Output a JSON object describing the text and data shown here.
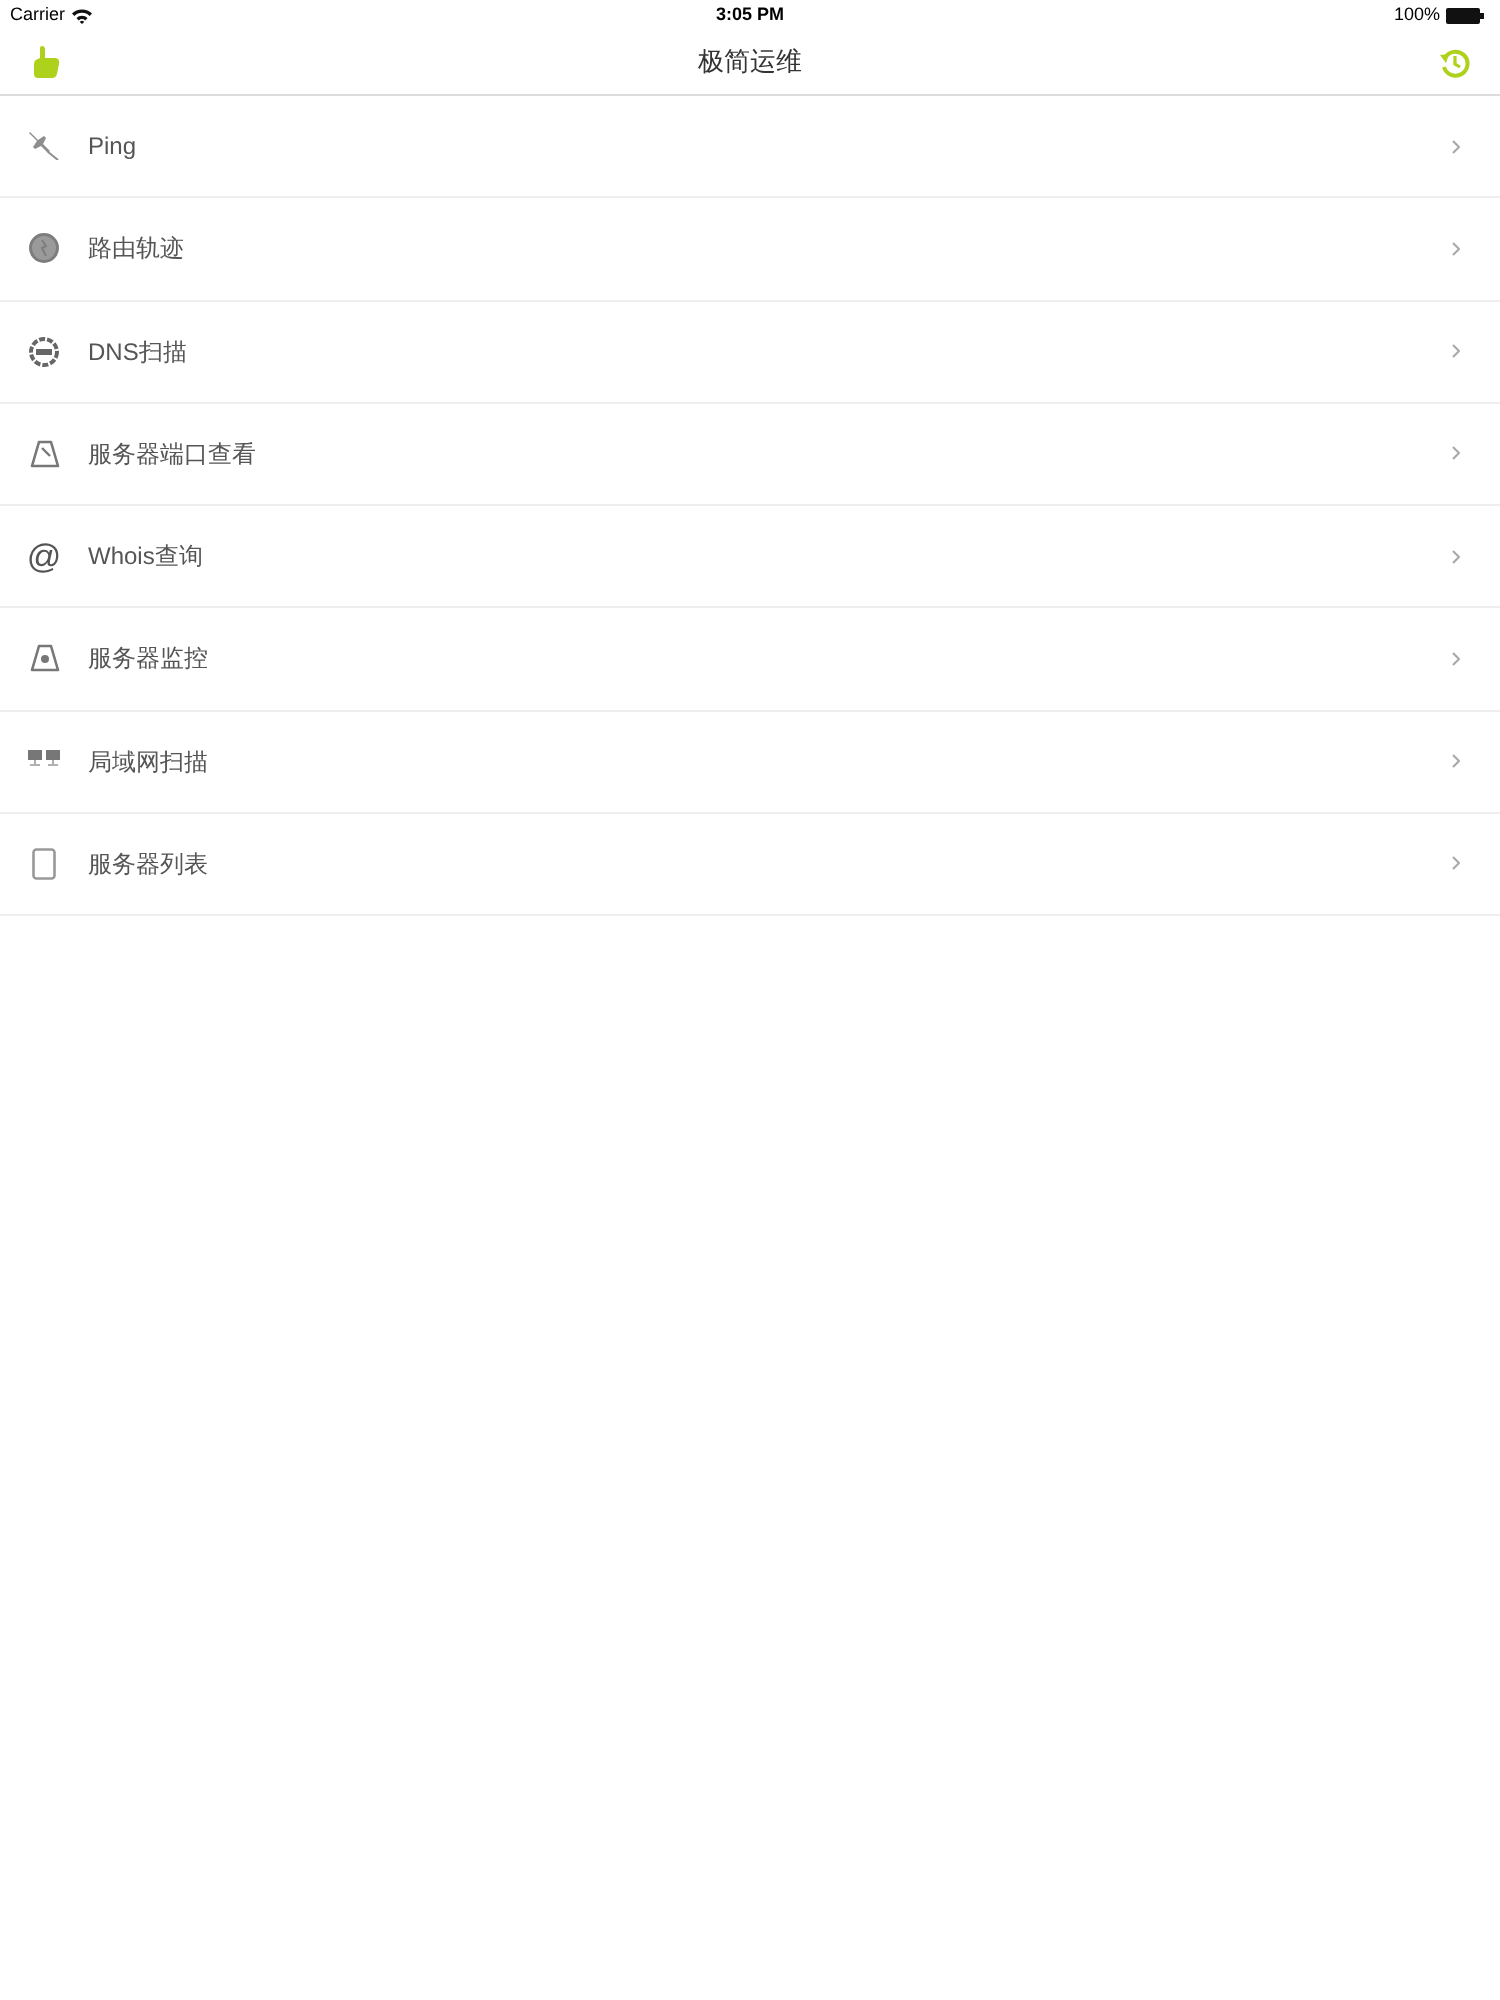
{
  "status_bar": {
    "carrier": "Carrier",
    "time": "3:05 PM",
    "battery": "100%"
  },
  "nav_bar": {
    "title": "极简运维"
  },
  "menu": {
    "items": [
      {
        "label": "Ping"
      },
      {
        "label": "路由轨迹"
      },
      {
        "label": "DNS扫描"
      },
      {
        "label": "服务器端口查看"
      },
      {
        "label": "Whois查询",
        "icon_char": "@"
      },
      {
        "label": "服务器监控"
      },
      {
        "label": "局域网扫描"
      },
      {
        "label": "服务器列表"
      }
    ]
  }
}
